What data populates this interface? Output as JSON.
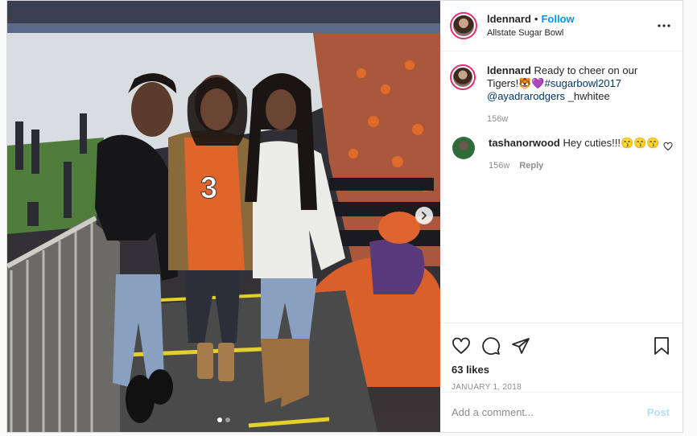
{
  "post": {
    "username": "ldennard",
    "follow_label": "Follow",
    "separator": "•",
    "location": "Allstate Sugar Bowl",
    "more_icon": "more-horizontal-icon",
    "caption": {
      "username": "ldennard",
      "text_start": "Ready to cheer on our Tigers!",
      "emojis": "🐯💜",
      "hashtag": "#sugarbowl2017",
      "mention": "@ayadrarodgers",
      "text_end": " _hwhitee",
      "age": "156w"
    },
    "comments": [
      {
        "username": "tashanorwood",
        "text": "Hey cuties!!!😙😙😙",
        "age": "156w",
        "reply_label": "Reply"
      }
    ],
    "likes": "63 likes",
    "date": "JANUARY 1, 2018",
    "add_comment_placeholder": "Add a comment...",
    "post_label": "Post",
    "carousel": {
      "slides": 2,
      "active": 1
    }
  },
  "colors": {
    "follow": "#0095f6",
    "link": "#00376b",
    "muted": "#8e8e8e",
    "post_disabled": "#b2dffc",
    "story_ring": "#e1306c"
  }
}
